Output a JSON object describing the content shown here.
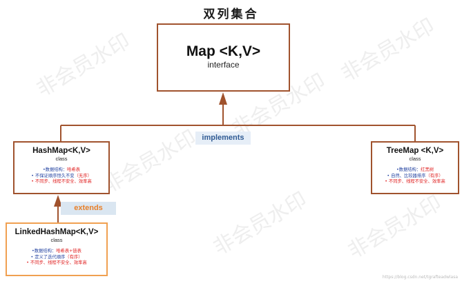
{
  "title": "双列集合",
  "nodes": {
    "map": {
      "name": "Map <K,V>",
      "kind": "interface"
    },
    "hashmap": {
      "name": "HashMap<K,V>",
      "kind": "class",
      "facts": [
        {
          "key": "•数据结构：",
          "value": "哈希表",
          "style": "blue"
        },
        {
          "key": "• 不保证顺序恒久不变",
          "value": "（无序）",
          "style": "blue"
        },
        {
          "key": "• 不同步、线程不安全、效率高",
          "value": "",
          "style": "red"
        }
      ]
    },
    "treemap": {
      "name": "TreeMap <K,V>",
      "kind": "class",
      "facts": [
        {
          "key": "•数据结构：",
          "value": "红黑树",
          "style": "blue"
        },
        {
          "key": "• 自然、比较器排序",
          "value": "（有序）",
          "style": "blue"
        },
        {
          "key": "• 不同步、线程不安全、效率高",
          "value": "",
          "style": "red"
        }
      ]
    },
    "linked": {
      "name": "LinkedHashMap<K,V>",
      "kind": "class",
      "facts": [
        {
          "key": "•数据结构：",
          "value": "哈希表+链表",
          "style": "blue"
        },
        {
          "key": "• 定义了迭代顺序",
          "value": "（有序）",
          "style": "blue"
        },
        {
          "key": "• 不同步、线程不安全、效率高",
          "value": "",
          "style": "red"
        }
      ]
    }
  },
  "edges": {
    "implements_label": "implements",
    "extends_label": "extends"
  },
  "watermark": "非会员水印",
  "credit": "https://blog.csdn.net/tgrafteadwlasa",
  "colors": {
    "box_border": "#a0522d",
    "linked_border": "#f0a050",
    "connector": "#a0522d",
    "fact_blue": "#1f3f9f",
    "fact_red": "#e02020"
  }
}
